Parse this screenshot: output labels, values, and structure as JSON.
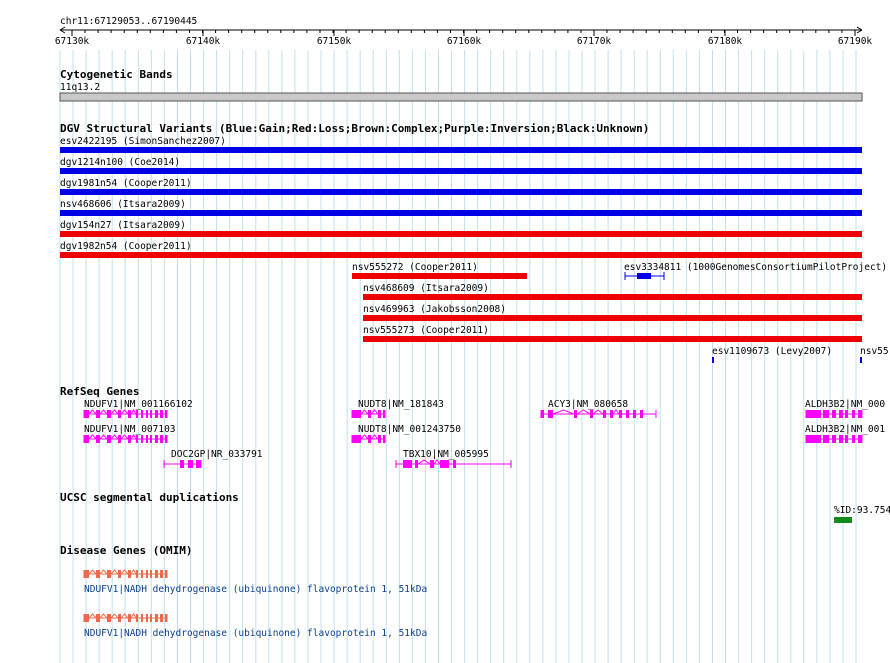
{
  "ruler": {
    "region": "chr11:67129053..67190445",
    "ticks": [
      "67130k",
      "67140k",
      "67150k",
      "67160k",
      "67170k",
      "67180k",
      "67190k"
    ]
  },
  "tracks": {
    "cytoband": {
      "title": "Cytogenetic Bands",
      "band": "11q13.2"
    },
    "dgv": {
      "title": "DGV Structural Variants (Blue:Gain;Red:Loss;Brown:Complex;Purple:Inversion;Black:Unknown)",
      "colors": {
        "gain": "#0000e6",
        "loss": "#ee0000"
      },
      "features": [
        {
          "label": "esv2422195 (SimonSanchez2007)",
          "type": "gain"
        },
        {
          "label": "dgv1214n100 (Coe2014)",
          "type": "gain"
        },
        {
          "label": "dgv1981n54 (Cooper2011)",
          "type": "gain"
        },
        {
          "label": "nsv468606 (Itsara2009)",
          "type": "gain"
        },
        {
          "label": "dgv154n27 (Itsara2009)",
          "type": "loss"
        },
        {
          "label": "dgv1982n54 (Cooper2011)",
          "type": "loss"
        },
        {
          "label": "nsv555272 (Cooper2011)",
          "type": "loss"
        },
        {
          "label": "esv3334811 (1000GenomesConsortiumPilotProject)",
          "type": "gain"
        },
        {
          "label": "nsv468609 (Itsara2009)",
          "type": "loss"
        },
        {
          "label": "nsv469963 (Jakobsson2008)",
          "type": "loss"
        },
        {
          "label": "nsv555273 (Cooper2011)",
          "type": "loss"
        },
        {
          "label": "esv1109673 (Levy2007)",
          "type": "gain"
        },
        {
          "label": "nsv55",
          "type": "gain"
        }
      ]
    },
    "refseq": {
      "title": "RefSeq Genes",
      "color": "#ff00ff",
      "genes": [
        "NDUFV1|NM_001166102",
        "NDUFV1|NM_007103",
        "DOC2GP|NR_033791",
        "NUDT8|NM_181843",
        "NUDT8|NM_001243750",
        "TBX10|NM_005995",
        "ACY3|NM_080658",
        "ALDH3B2|NM_000",
        "ALDH3B2|NM_001"
      ]
    },
    "segdup": {
      "title": "UCSC segmental duplications",
      "label": "%ID:93.754",
      "color": "#128a1c"
    },
    "omim": {
      "title": "Disease Genes (OMIM)",
      "color": "#ee6a4a",
      "genes": [
        "NDUFV1|NADH dehydrogenase (ubiquinone) flavoprotein 1, 51kDa",
        "NDUFV1|NADH dehydrogenase (ubiquinone) flavoprotein 1, 51kDa"
      ]
    }
  }
}
